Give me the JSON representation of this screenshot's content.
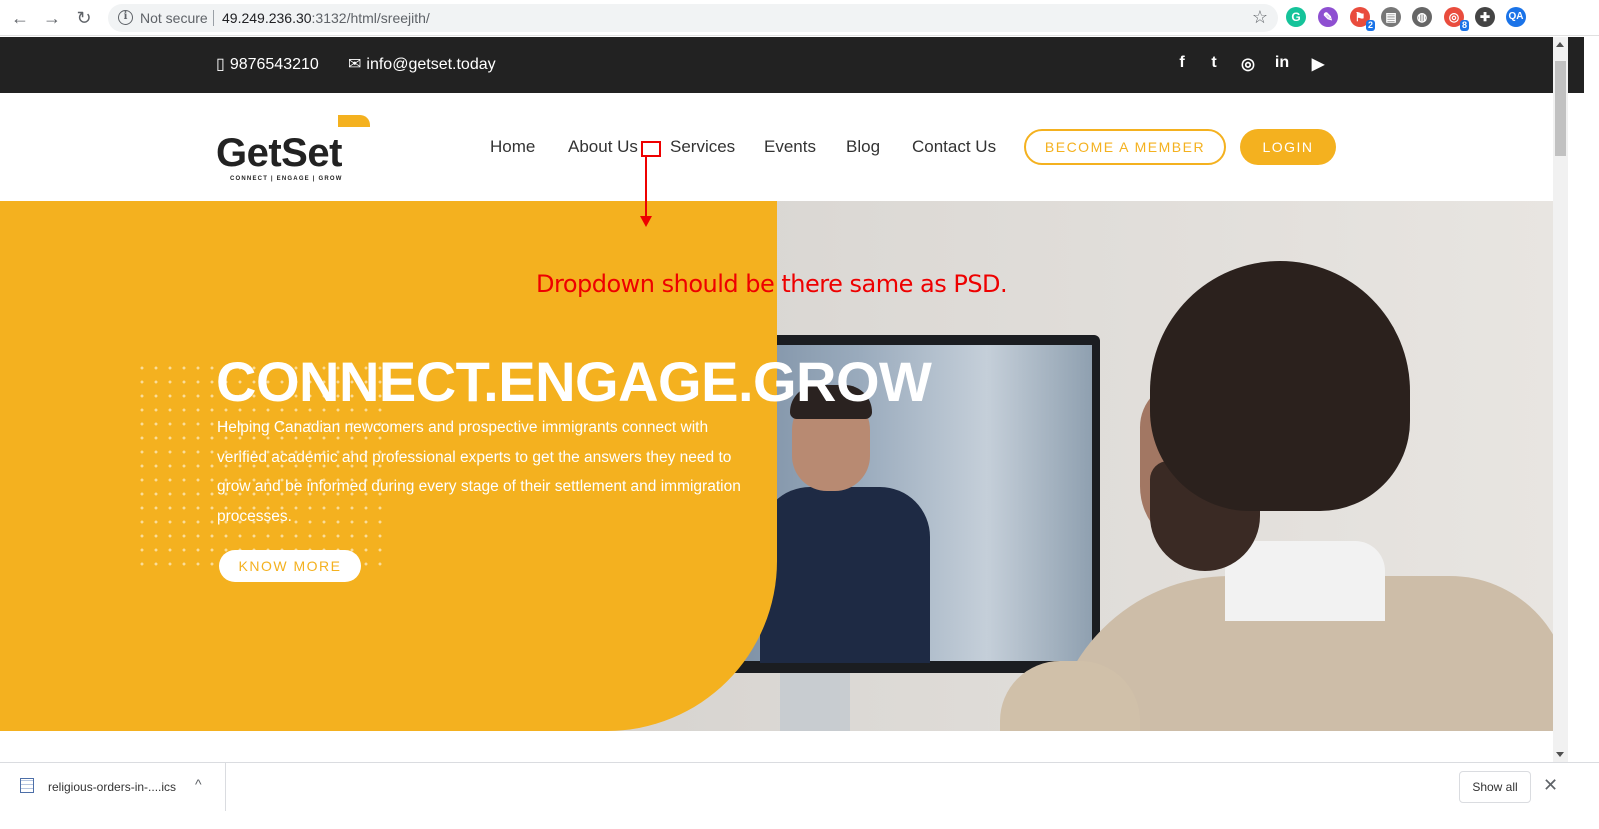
{
  "browser": {
    "back_icon": "←",
    "forward_icon": "→",
    "reload_icon": "↻",
    "info_icon": "i",
    "security_label": "Not secure",
    "url_host": "49.249.236.30",
    "url_path": ":3132/html/sreejith/",
    "star_icon": "☆",
    "extensions": [
      {
        "name": "grammarly",
        "glyph": "G",
        "color": "#15c39a",
        "badge": ""
      },
      {
        "name": "feather",
        "glyph": "✎",
        "color": "#8e4fd1",
        "badge": ""
      },
      {
        "name": "extension-red",
        "glyph": "⚑",
        "color": "#e94c3d",
        "badge": "2"
      },
      {
        "name": "document",
        "glyph": "▤",
        "color": "#555555",
        "badge": ""
      },
      {
        "name": "globe",
        "glyph": "◍",
        "color": "#555555",
        "badge": ""
      },
      {
        "name": "fingerprint",
        "glyph": "◎",
        "color": "#e94c3d",
        "badge": "8"
      },
      {
        "name": "puzzle",
        "glyph": "✚",
        "color": "#333333",
        "badge": ""
      },
      {
        "name": "qa",
        "glyph": "QA",
        "color": "#1a73e8",
        "badge": ""
      }
    ]
  },
  "topbar": {
    "phone_icon": "▯",
    "phone": "9876543210",
    "email_icon": "✉",
    "email": "info@getset.today",
    "social": [
      "f",
      "t",
      "◎",
      "in",
      "▶"
    ]
  },
  "header": {
    "logo_text": "GetSet",
    "logo_tagline": "CONNECT | ENGAGE | GROW",
    "menu": [
      "Home",
      "About Us",
      "Services",
      "Events",
      "Blog",
      "Contact Us"
    ],
    "member_button": "BECOME A MEMBER",
    "login_button": "LOGIN"
  },
  "hero": {
    "title": "CONNECT.ENGAGE.GROW",
    "text": "Helping Canadian newcomers and prospective immigrants connect with verified academic and professional experts to get the answers they need to grow and be informed during every stage of their settlement and immigration processes.",
    "cta": "KNOW MORE"
  },
  "annotation": {
    "text": "Dropdown should be there same as PSD.",
    "color": "#ee0000"
  },
  "downloads": {
    "file_name": "religious-orders-in-....ics",
    "chevron": "^",
    "show_all": "Show all",
    "close_icon": "✕"
  },
  "colors": {
    "brand_yellow": "#f4b11f",
    "topbar_dark": "#222222"
  }
}
